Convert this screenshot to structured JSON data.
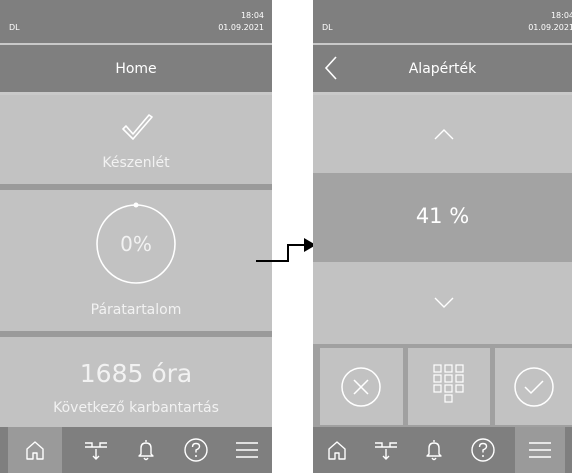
{
  "left": {
    "status": {
      "dl": "DL",
      "time": "18:04",
      "date": "01.09.2021"
    },
    "title": "Home",
    "status_panel": {
      "label": "Készenlét",
      "icon": "checkmark-icon"
    },
    "humidity_panel": {
      "value": "0%",
      "label": "Páratartalom"
    },
    "maintenance_panel": {
      "value": "1685 óra",
      "label": "Következő karbantartás"
    },
    "nav": [
      {
        "icon": "home-icon",
        "active": true
      },
      {
        "icon": "drain-icon"
      },
      {
        "icon": "bell-icon"
      },
      {
        "icon": "help-icon"
      },
      {
        "icon": "menu-icon"
      }
    ]
  },
  "right": {
    "status": {
      "dl": "DL",
      "time": "18:04",
      "date": "01.09.2021"
    },
    "title": "Alapérték",
    "value": "41 %",
    "buttons": [
      {
        "icon": "cancel-icon"
      },
      {
        "icon": "keypad-icon"
      },
      {
        "icon": "confirm-icon"
      }
    ],
    "nav": [
      {
        "icon": "home-icon"
      },
      {
        "icon": "drain-icon"
      },
      {
        "icon": "bell-icon"
      },
      {
        "icon": "help-icon"
      },
      {
        "icon": "menu-icon",
        "active": true
      }
    ]
  },
  "colors": {
    "bar": "#7f7f7f",
    "panel": "#c2c2c2",
    "nav_active": "#9a9a9a",
    "highlight": "#a3a3a3",
    "text": "#ffffff"
  }
}
